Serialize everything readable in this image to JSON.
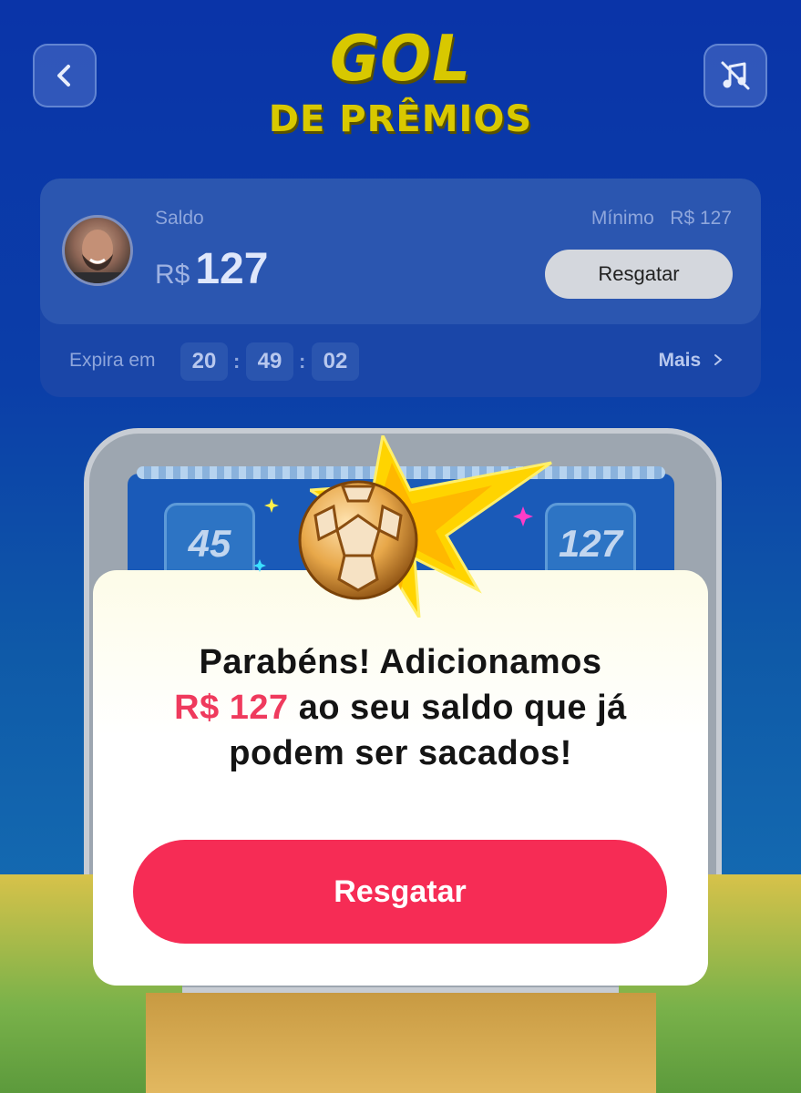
{
  "header": {
    "logo_line1": "GOL",
    "logo_line2": "DE PRÊMIOS",
    "back_icon": "chevron-left-icon",
    "music_icon": "music-off-icon"
  },
  "balance": {
    "saldo_label": "Saldo",
    "currency": "R$",
    "amount": "127",
    "minimo_label": "Mínimo",
    "minimo_value": "R$ 127",
    "button_label": "Resgatar",
    "expira_label": "Expira em",
    "hours": "20",
    "minutes": "49",
    "seconds": "02",
    "sep": ":",
    "mais_label": "Mais",
    "mais_icon": "chevron-right-icon"
  },
  "game": {
    "slots": [
      "45",
      "127"
    ]
  },
  "modal": {
    "line1": "Parabéns! Adicionamos",
    "amount": "R$ 127",
    "line2_rest": " ao seu saldo que já",
    "line3": "podem ser sacados!",
    "button_label": "Resgatar"
  },
  "colors": {
    "accent": "#f62c55",
    "highlight": "#ef3a5d",
    "logo": "#d8c800",
    "background": "#0b3ea8"
  }
}
